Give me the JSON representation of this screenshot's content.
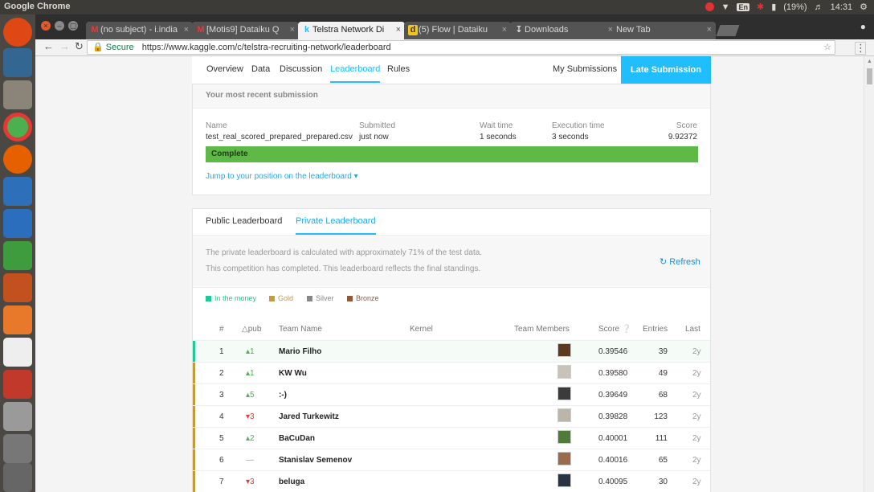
{
  "os": {
    "app_title": "Google Chrome",
    "battery": "(19%)",
    "time": "14:31",
    "keyboard": "En"
  },
  "browser": {
    "tabs": [
      {
        "label": "(no subject) - i.india",
        "favicon": "M"
      },
      {
        "label": "[Motis9] Dataiku Q",
        "favicon": "M"
      },
      {
        "label": "Telstra Network Di",
        "favicon": "k"
      },
      {
        "label": "(5) Flow | Dataiku",
        "favicon": "d"
      },
      {
        "label": "Downloads",
        "favicon": "download-icon"
      },
      {
        "label": "New Tab",
        "favicon": ""
      }
    ],
    "secure_label": "Secure",
    "url": "https://www.kaggle.com/c/telstra-recruiting-network/leaderboard"
  },
  "subnav": {
    "items": [
      "Overview",
      "Data",
      "Discussion",
      "Leaderboard",
      "Rules"
    ],
    "my_submissions": "My Submissions",
    "late_submission": "Late Submission"
  },
  "submission": {
    "header": "Your most recent submission",
    "name_label": "Name",
    "name": "test_real_scored_prepared_prepared.csv",
    "submitted_label": "Submitted",
    "submitted": "just now",
    "wait_label": "Wait time",
    "wait": "1 seconds",
    "exec_label": "Execution time",
    "exec": "3 seconds",
    "score_label": "Score",
    "score": "9.92372",
    "status": "Complete",
    "jump": "Jump to your position on the leaderboard"
  },
  "leaderboard": {
    "tabs": [
      "Public Leaderboard",
      "Private Leaderboard"
    ],
    "note1": "The private leaderboard is calculated with approximately 71% of the test data.",
    "note2": "This competition has completed. This leaderboard reflects the final standings.",
    "refresh": "Refresh",
    "legend": [
      {
        "label": "In the money",
        "color": "#20c997"
      },
      {
        "label": "Gold",
        "color": "#c59a3b"
      },
      {
        "label": "Silver",
        "color": "#888888"
      },
      {
        "label": "Bronze",
        "color": "#8d5b3a"
      }
    ],
    "columns": {
      "rank": "#",
      "delta": "△pub",
      "team": "Team Name",
      "kernel": "Kernel",
      "members": "Team Members",
      "score": "Score",
      "entries": "Entries",
      "last": "Last"
    },
    "rows": [
      {
        "rank": "1",
        "delta": "1",
        "dir": "up",
        "team": "Mario Filho",
        "score": "0.39546",
        "entries": "39",
        "last": "2y",
        "tier": "money"
      },
      {
        "rank": "2",
        "delta": "1",
        "dir": "up",
        "team": "KW Wu",
        "score": "0.39580",
        "entries": "49",
        "last": "2y",
        "tier": "gold"
      },
      {
        "rank": "3",
        "delta": "5",
        "dir": "up",
        "team": ":-)",
        "score": "0.39649",
        "entries": "68",
        "last": "2y",
        "tier": "gold"
      },
      {
        "rank": "4",
        "delta": "3",
        "dir": "down",
        "team": "Jared Turkewitz",
        "score": "0.39828",
        "entries": "123",
        "last": "2y",
        "tier": "gold"
      },
      {
        "rank": "5",
        "delta": "2",
        "dir": "up",
        "team": "BaCuDan",
        "score": "0.40001",
        "entries": "111",
        "last": "2y",
        "tier": "gold"
      },
      {
        "rank": "6",
        "delta": "—",
        "dir": "none",
        "team": "Stanislav Semenov",
        "score": "0.40016",
        "entries": "65",
        "last": "2y",
        "tier": "gold"
      },
      {
        "rank": "7",
        "delta": "3",
        "dir": "down",
        "team": "beluga",
        "score": "0.40095",
        "entries": "30",
        "last": "2y",
        "tier": "gold"
      }
    ]
  }
}
